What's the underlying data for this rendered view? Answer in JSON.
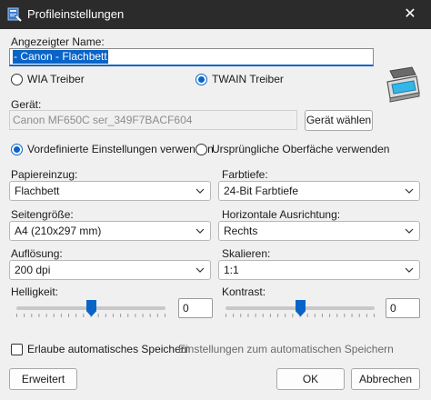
{
  "window": {
    "title": "Profileinstellungen",
    "close_glyph": "✕"
  },
  "name": {
    "label": "Angezeigter Name:",
    "value": "- Canon - Flachbett"
  },
  "driver": {
    "wia_label": "WIA Treiber",
    "twain_label": "TWAIN Treiber",
    "selected": "twain"
  },
  "device": {
    "label": "Gerät:",
    "value": "Canon MF650C ser_349F7BACF604",
    "choose_button": "Gerät wählen"
  },
  "settings_mode": {
    "predefined_label": "Vordefinierte Einstellungen verwenden",
    "native_label": "Ursprüngliche Oberfäche verwenden",
    "selected": "predefined"
  },
  "paper_source": {
    "label": "Papiereinzug:",
    "value": "Flachbett"
  },
  "color_depth": {
    "label": "Farbtiefe:",
    "value": "24-Bit Farbtiefe"
  },
  "page_size": {
    "label": "Seitengröße:",
    "value": "A4 (210x297 mm)"
  },
  "h_align": {
    "label": "Horizontale Ausrichtung:",
    "value": "Rechts"
  },
  "resolution": {
    "label": "Auflösung:",
    "value": "200 dpi"
  },
  "scale": {
    "label": "Skalieren:",
    "value": "1:1"
  },
  "brightness": {
    "label": "Helligkeit:",
    "value": "0",
    "level": 0.5
  },
  "contrast": {
    "label": "Kontrast:",
    "value": "0",
    "level": 0.5
  },
  "autosave": {
    "checkbox_label": "Erlaube automatisches Speichern",
    "link_label": "Einstellungen zum automatischen Speichern",
    "checked": false
  },
  "buttons": {
    "advanced": "Erweitert",
    "ok": "OK",
    "cancel": "Abbrechen"
  },
  "colors": {
    "accent": "#0a64c8",
    "titlebar": "#2b2b2b",
    "background": "#f0f0f0"
  },
  "icons": {
    "app": "scanner-app-icon",
    "scanner": "scanner-icon",
    "dropdown": "chevron-down-icon"
  }
}
